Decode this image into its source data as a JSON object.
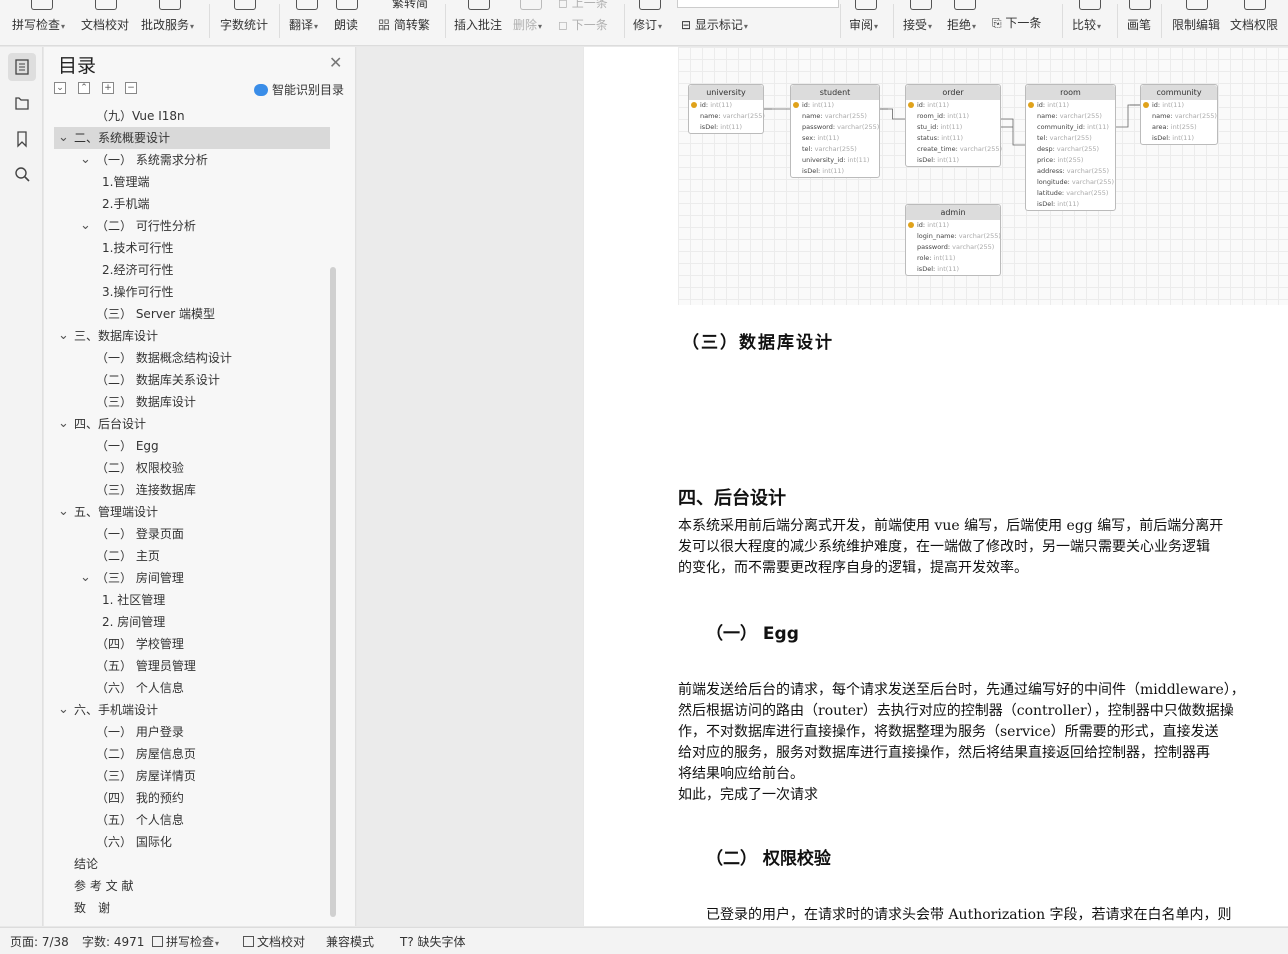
{
  "ribbon": {
    "spell_check": "拼写检查",
    "doc_proof": "文档校对",
    "batch_service": "批改服务",
    "word_count": "字数统计",
    "translate": "翻译",
    "read_aloud": "朗读",
    "simp_trad": "繁转简",
    "trad_simp": "简转繁",
    "insert_comment": "插入批注",
    "delete": "删除",
    "prev": "上一条",
    "next": "下一条",
    "revise": "修订",
    "show_markup": "显示标记",
    "review": "审阅",
    "accept": "接受",
    "reject": "拒绝",
    "next_change": "下一条",
    "compare": "比较",
    "ink": "画笔",
    "restrict_edit": "限制编辑",
    "doc_permission": "文档权限"
  },
  "toc": {
    "title": "目录",
    "smart_toc": "智能识别目录",
    "items": [
      {
        "label": "（九）Vue I18n",
        "level": 1,
        "toggle": ""
      },
      {
        "label": "二、系统概要设计",
        "level": 0,
        "toggle": "v",
        "selected": true
      },
      {
        "label": "（一） 系统需求分析",
        "level": 1,
        "toggle": "v"
      },
      {
        "label": "1.管理端",
        "level": 2,
        "toggle": ""
      },
      {
        "label": "2.手机端",
        "level": 2,
        "toggle": ""
      },
      {
        "label": "（二） 可行性分析",
        "level": 1,
        "toggle": "v"
      },
      {
        "label": "1.技术可行性",
        "level": 2,
        "toggle": ""
      },
      {
        "label": "2.经济可行性",
        "level": 2,
        "toggle": ""
      },
      {
        "label": "3.操作可行性",
        "level": 2,
        "toggle": ""
      },
      {
        "label": "（三） Server 端模型",
        "level": 1,
        "toggle": ""
      },
      {
        "label": "三、数据库设计",
        "level": 0,
        "toggle": "v"
      },
      {
        "label": "（一） 数据概念结构设计",
        "level": 1,
        "toggle": ""
      },
      {
        "label": "（二） 数据库关系设计",
        "level": 1,
        "toggle": ""
      },
      {
        "label": "（三） 数据库设计",
        "level": 1,
        "toggle": ""
      },
      {
        "label": "四、后台设计",
        "level": 0,
        "toggle": "v"
      },
      {
        "label": "（一）  Egg",
        "level": 1,
        "toggle": ""
      },
      {
        "label": "（二）  权限校验",
        "level": 1,
        "toggle": ""
      },
      {
        "label": "（三） 连接数据库",
        "level": 1,
        "toggle": ""
      },
      {
        "label": "五、管理端设计",
        "level": 0,
        "toggle": "v"
      },
      {
        "label": "（一） 登录页面",
        "level": 1,
        "toggle": ""
      },
      {
        "label": "（二） 主页",
        "level": 1,
        "toggle": ""
      },
      {
        "label": "（三） 房间管理",
        "level": 1,
        "toggle": "v"
      },
      {
        "label": "1. 社区管理",
        "level": 2,
        "toggle": ""
      },
      {
        "label": "2. 房间管理",
        "level": 2,
        "toggle": ""
      },
      {
        "label": "（四） 学校管理",
        "level": 1,
        "toggle": ""
      },
      {
        "label": "（五） 管理员管理",
        "level": 1,
        "toggle": ""
      },
      {
        "label": "（六） 个人信息",
        "level": 1,
        "toggle": ""
      },
      {
        "label": "六、手机端设计",
        "level": 0,
        "toggle": "v"
      },
      {
        "label": "（一） 用户登录",
        "level": 1,
        "toggle": ""
      },
      {
        "label": "（二） 房屋信息页",
        "level": 1,
        "toggle": ""
      },
      {
        "label": "（三） 房屋详情页",
        "level": 1,
        "toggle": ""
      },
      {
        "label": "（四） 我的预约",
        "level": 1,
        "toggle": ""
      },
      {
        "label": "（五） 个人信息",
        "level": 1,
        "toggle": ""
      },
      {
        "label": "（六） 国际化",
        "level": 1,
        "toggle": ""
      },
      {
        "label": "结论",
        "level": 0,
        "toggle": ""
      },
      {
        "label": "参 考 文 献",
        "level": 0,
        "toggle": ""
      },
      {
        "label": "致　谢",
        "level": 0,
        "toggle": ""
      }
    ]
  },
  "erd": {
    "tables": [
      {
        "name": "university",
        "fields": [
          [
            "id",
            "int(11)",
            true
          ],
          [
            "name",
            "varchar(255)",
            false
          ],
          [
            "isDel",
            "int(11)",
            false
          ]
        ]
      },
      {
        "name": "student",
        "fields": [
          [
            "id",
            "int(11)",
            true
          ],
          [
            "name",
            "varchar(255)",
            false
          ],
          [
            "password",
            "varchar(255)",
            false
          ],
          [
            "sex",
            "int(11)",
            false
          ],
          [
            "tel",
            "varchar(255)",
            false
          ],
          [
            "university_id",
            "int(11)",
            false
          ],
          [
            "isDel",
            "int(11)",
            false
          ]
        ]
      },
      {
        "name": "order",
        "fields": [
          [
            "id",
            "int(11)",
            true
          ],
          [
            "room_id",
            "int(11)",
            false
          ],
          [
            "stu_id",
            "int(11)",
            false
          ],
          [
            "status",
            "int(11)",
            false
          ],
          [
            "create_time",
            "varchar(255)",
            false
          ],
          [
            "isDel",
            "int(11)",
            false
          ]
        ]
      },
      {
        "name": "room",
        "fields": [
          [
            "id",
            "int(11)",
            true
          ],
          [
            "name",
            "varchar(255)",
            false
          ],
          [
            "community_id",
            "int(11)",
            false
          ],
          [
            "tel",
            "varchar(255)",
            false
          ],
          [
            "desp",
            "varchar(255)",
            false
          ],
          [
            "price",
            "int(255)",
            false
          ],
          [
            "address",
            "varchar(255)",
            false
          ],
          [
            "longitude",
            "varchar(255)",
            false
          ],
          [
            "latitude",
            "varchar(255)",
            false
          ],
          [
            "isDel",
            "int(11)",
            false
          ]
        ]
      },
      {
        "name": "community",
        "fields": [
          [
            "id",
            "int(11)",
            true
          ],
          [
            "name",
            "varchar(255)",
            false
          ],
          [
            "area",
            "int(255)",
            false
          ],
          [
            "isDel",
            "int(11)",
            false
          ]
        ]
      },
      {
        "name": "admin",
        "fields": [
          [
            "id",
            "int(11)",
            true
          ],
          [
            "login_name",
            "varchar(255)",
            false
          ],
          [
            "password",
            "varchar(255)",
            false
          ],
          [
            "role",
            "int(11)",
            false
          ],
          [
            "isDel",
            "int(11)",
            false
          ]
        ]
      }
    ]
  },
  "document": {
    "h_db_design": "（三）数据库设计",
    "h_backend": "四、后台设计",
    "p_backend": [
      "本系统采用前后端分离式开发，前端使用 vue 编写，后端使用 egg 编写，前后端分离开",
      "发可以很大程度的减少系统维护难度，在一端做了修改时，另一端只需要关心业务逻辑",
      "的变化，而不需要更改程序自身的逻辑，提高开发效率。"
    ],
    "h_egg": "（一）  Egg",
    "p_egg": [
      "前端发送给后台的请求，每个请求发送至后台时，先通过编写好的中间件（middleware），",
      "然后根据访问的路由（router）去执行对应的控制器（controller），控制器中只做数据操",
      "作，不对数据库进行直接操作，将数据整理为服务（service）所需要的形式，直接发送",
      "给对应的服务，服务对数据库进行直接操作，然后将结果直接返回给控制器，控制器再",
      "将结果响应给前台。",
      "如此，完成了一次请求"
    ],
    "h_auth": "（二）  权限校验",
    "p_auth": "已登录的用户，在请求时的请求头会带 Authorization 字段，若请求在白名单内，则"
  },
  "status": {
    "page": "页面: 7/38",
    "words": "字数: 4971",
    "spell": "拼写检查",
    "proof": "文档校对",
    "compat": "兼容模式",
    "missing_font": "缺失字体"
  }
}
